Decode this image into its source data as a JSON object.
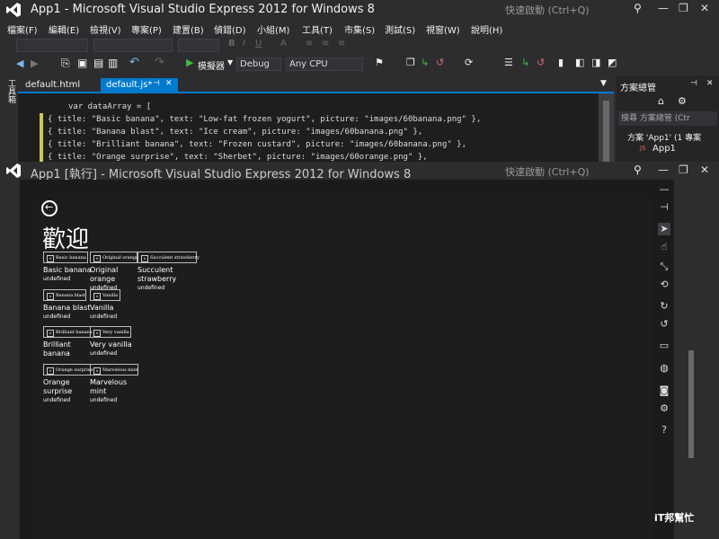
{
  "main_window": {
    "title": "App1 - Microsoft Visual Studio Express 2012 for Windows 8",
    "quick_launch": "快速啟動 (Ctrl+Q)",
    "menu": [
      "檔案(F)",
      "編輯(E)",
      "檢視(V)",
      "專案(P)",
      "建置(B)",
      "偵錯(D)",
      "小組(M)",
      "工具(T)",
      "市集(S)",
      "測試(S)",
      "視窗(W)",
      "說明(H)"
    ],
    "toolbar": {
      "run_label": "模擬器",
      "config": "Debug",
      "platform": "Any CPU"
    },
    "left_rail_label": "工具箱",
    "tabs": [
      {
        "label": "default.html"
      },
      {
        "label": "default.js*"
      }
    ],
    "code_lines": [
      "var dataArray = [",
      "{ title: \"Basic banana\", text: \"Low-fat frozen yogurt\", picture: \"images/60banana.png\" },",
      "{ title: \"Banana blast\", text: \"Ice cream\", picture: \"images/60banana.png\" },",
      "{ title: \"Brilliant banana\", text: \"Frozen custard\", picture: \"images/60banana.png\" },",
      "{ title: \"Orange surprise\", text: \"Sherbet\", picture: \"images/60orange.png\" },"
    ],
    "solution_explorer": {
      "title": "方案總管",
      "search_placeholder": "搜尋 方案總管 (Ctr",
      "solution_item": "方案 'App1' (1 專案",
      "project_item": "App1"
    }
  },
  "simulator_window": {
    "title": "App1 [執行] - Microsoft Visual Studio Express 2012 for Windows 8",
    "quick_launch": "快速啟動 (Ctrl+Q)"
  },
  "app": {
    "heading": "歡迎",
    "subtitle": "undefined",
    "items": [
      {
        "title": "Basic banana",
        "line1": "Basic banana",
        "line2": ""
      },
      {
        "title": "Original orange",
        "line1": "Original",
        "line2": "orange"
      },
      {
        "title": "Succulent strawberry",
        "line1": "Succulent",
        "line2": "strawberry"
      },
      {
        "title": "Banana blast",
        "line1": "Banana blast",
        "line2": ""
      },
      {
        "title": "Vanilla",
        "line1": "Vanilla",
        "line2": ""
      },
      {
        "title": "Brilliant banana",
        "line1": "Brilliant",
        "line2": "banana"
      },
      {
        "title": "Very vanilla",
        "line1": "Very vanilla",
        "line2": ""
      },
      {
        "title": "Orange surprise",
        "line1": "Orange",
        "line2": "surprise"
      },
      {
        "title": "Marvelous mint",
        "line1": "Marvelous",
        "line2": "mint"
      }
    ]
  },
  "watermark": "iT邦幫忙",
  "colors": {
    "accent": "#007acc",
    "run_green": "#3ebc3e",
    "chrome": "#2d2d30",
    "editor_bg": "#1e1e1e"
  }
}
